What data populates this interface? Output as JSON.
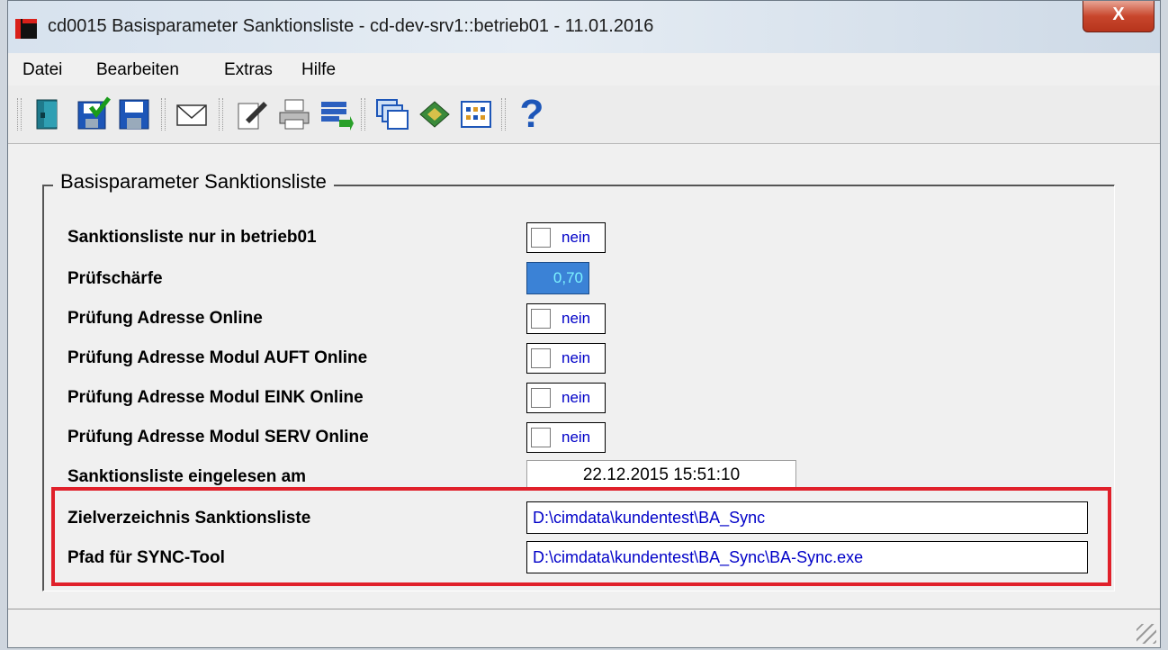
{
  "window": {
    "title": "cd0015 Basisparameter Sanktionsliste - cd-dev-srv1::betrieb01 - 11.01.2016",
    "close_label": "X"
  },
  "menu": [
    "Datei",
    "Bearbeiten",
    "Extras",
    "Hilfe"
  ],
  "toolbar": {
    "icons": [
      "exit-icon",
      "save-check-icon",
      "save-icon",
      "mail-icon",
      "edit-doc-icon",
      "print-icon",
      "export-icon",
      "windows-icon",
      "book-icon",
      "grid-icon",
      "help-icon"
    ],
    "help_label": "?"
  },
  "group": {
    "title": "Basisparameter Sanktionsliste",
    "rows": [
      {
        "label": "Sanktionsliste nur in betrieb01",
        "value": "nein"
      },
      {
        "label": "Prüfschärfe",
        "value": "0,70"
      },
      {
        "label": "Prüfung Adresse Online",
        "value": "nein"
      },
      {
        "label": "Prüfung Adresse Modul AUFT Online",
        "value": "nein"
      },
      {
        "label": "Prüfung Adresse Modul EINK Online",
        "value": "nein"
      },
      {
        "label": "Prüfung Adresse Modul SERV Online",
        "value": "nein"
      },
      {
        "label": "Sanktionsliste eingelesen am",
        "value": "22.12.2015 15:51:10"
      },
      {
        "label": "Zielverzeichnis Sanktionsliste",
        "value": "D:\\cimdata\\kundentest\\BA_Sync"
      },
      {
        "label": "Pfad für SYNC-Tool",
        "value": "D:\\cimdata\\kundentest\\BA_Sync\\BA-Sync.exe"
      }
    ]
  },
  "colors": {
    "highlight": "#e0202a",
    "value_text": "#0000c8",
    "selected_field": "#3b82d6"
  }
}
